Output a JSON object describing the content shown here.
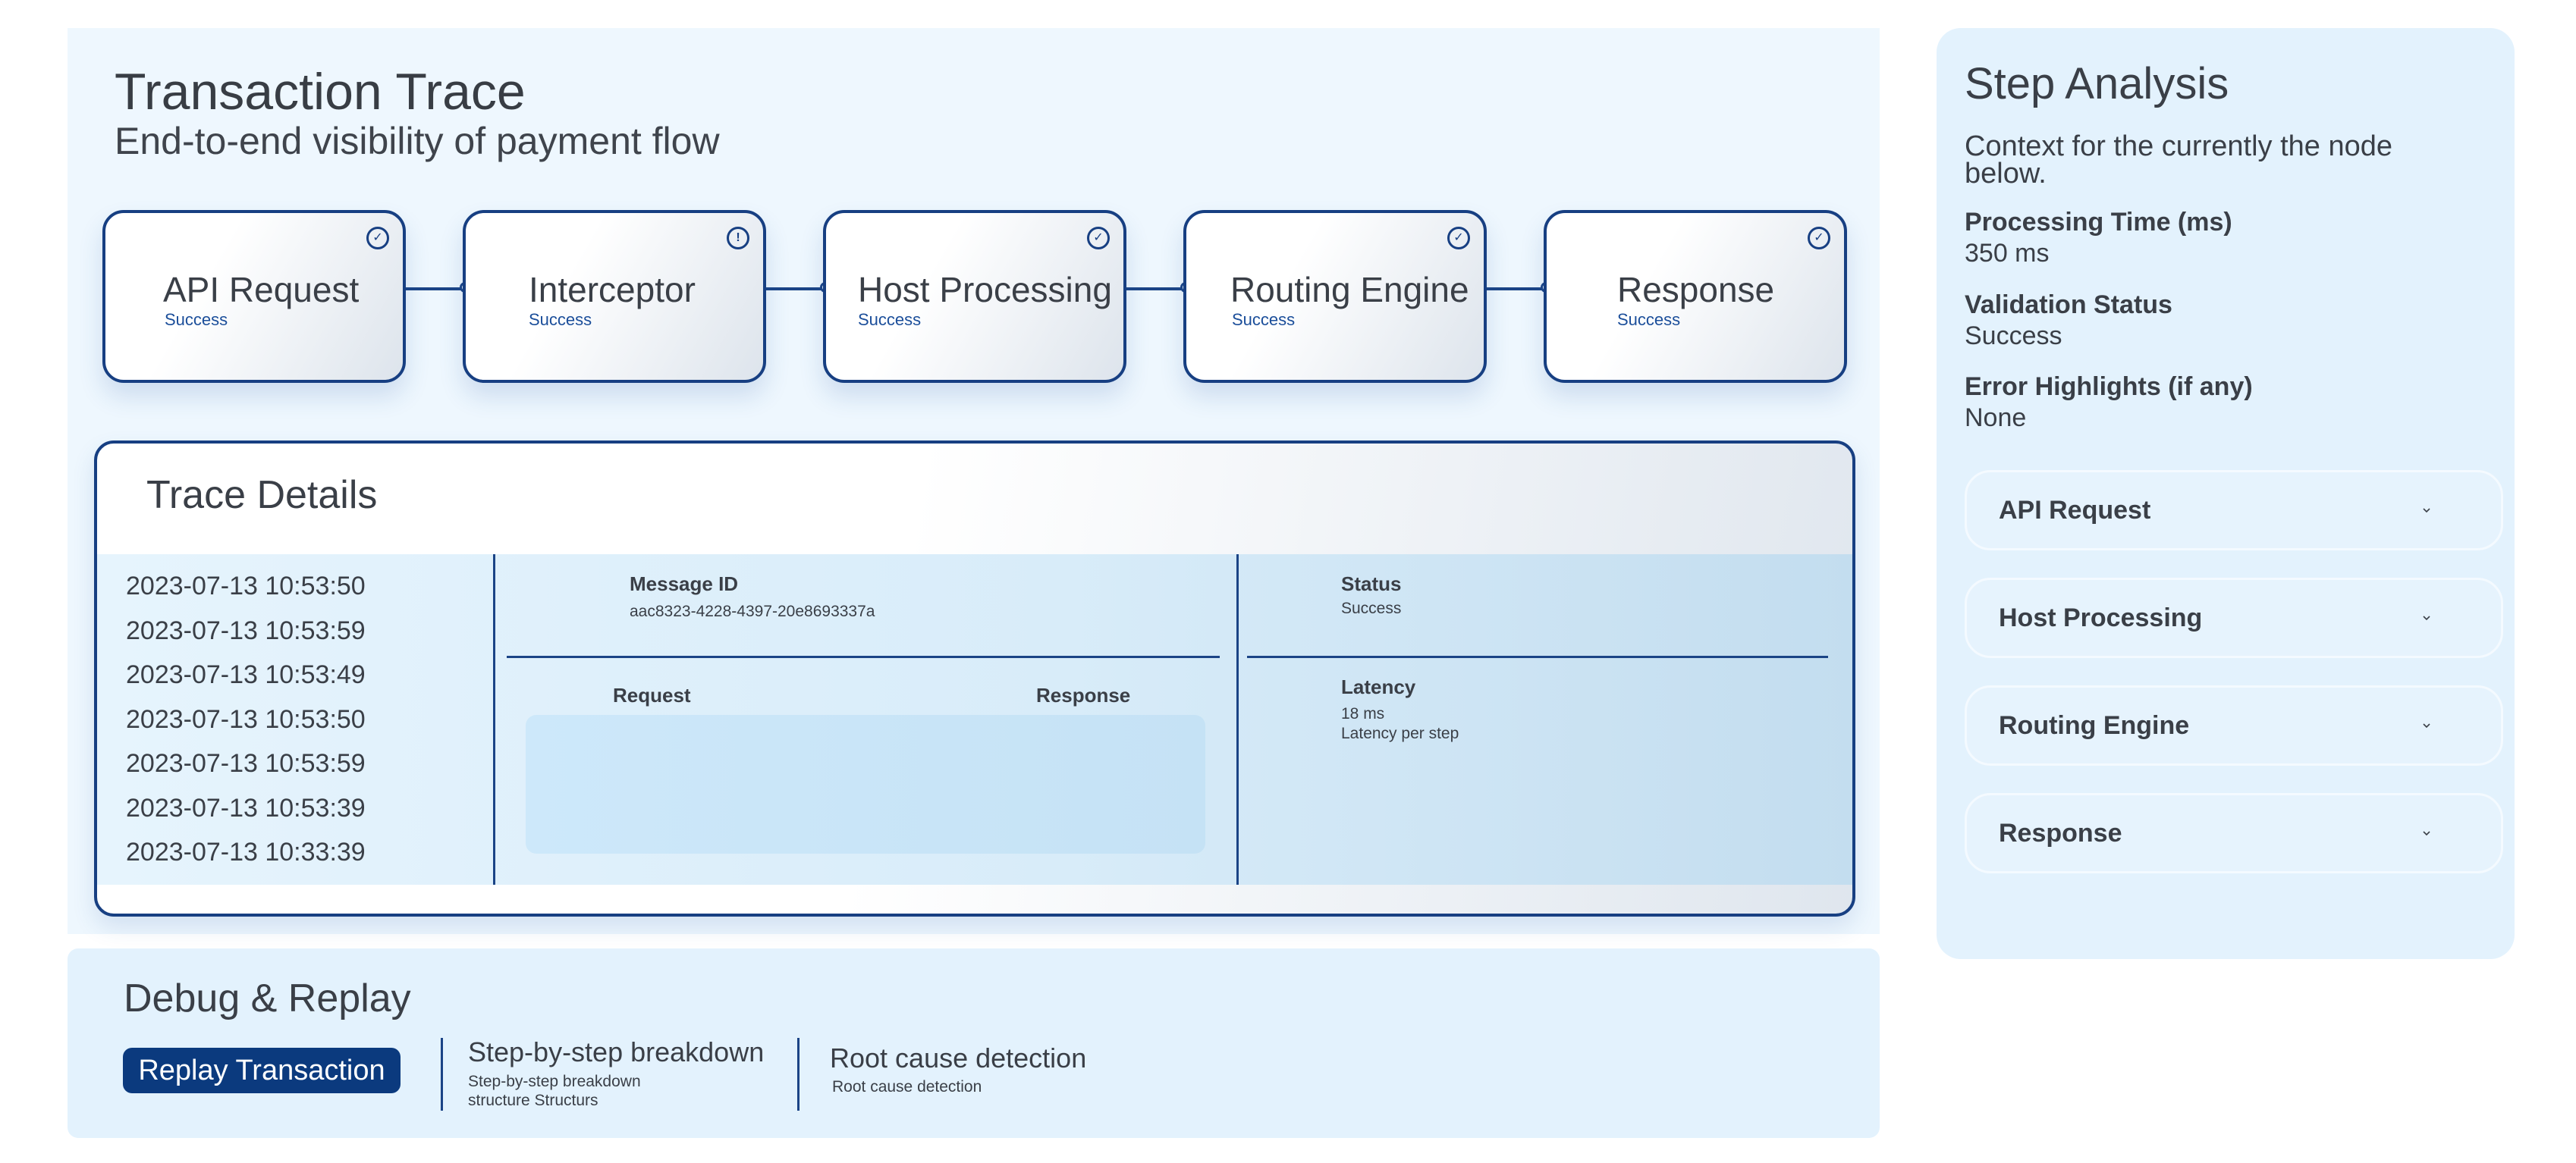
{
  "header": {
    "title": "Transaction Trace",
    "subtitle": "End-to-end visibility of payment flow"
  },
  "flow": {
    "nodes": [
      {
        "label": "API Request",
        "status": "Success",
        "badge": "check-icon"
      },
      {
        "label": "Interceptor",
        "status": "Success",
        "badge": "alert-icon"
      },
      {
        "label": "Host Processing",
        "status": "Success",
        "badge": "check-icon"
      },
      {
        "label": "Routing Engine",
        "status": "Success",
        "badge": "check-icon"
      },
      {
        "label": "Response",
        "status": "Success",
        "badge": "check-icon"
      }
    ]
  },
  "trace": {
    "title": "Trace Details",
    "timestamps": [
      "2023-07-13 10:53:50",
      "2023-07-13 10:53:59",
      "2023-07-13 10:53:49",
      "2023-07-13 10:53:50",
      "2023-07-13 10:53:59",
      "2023-07-13 10:53:39",
      "2023-07-13 10:33:39"
    ],
    "message_id_label": "Message ID",
    "message_id_value": "aac8323-4228-4397-20e8693337a",
    "request_label": "Request",
    "response_label": "Response",
    "status_label": "Status",
    "status_value": "Success",
    "latency_label": "Latency",
    "latency_value": "18 ms",
    "latency_note": "Latency per step"
  },
  "debug": {
    "title": "Debug & Replay",
    "replay_label": "Replay Transaction",
    "breakdown_title": "Step-by-step breakdown",
    "breakdown_sub1": "Step-by-step breakdown",
    "breakdown_sub2": "structure Structurs",
    "root_title": "Root cause detection",
    "root_sub": "Root cause detection"
  },
  "side": {
    "title": "Step Analysis",
    "description": "Context for the currently the node below.",
    "metrics": [
      {
        "label": "Processing Time (ms)",
        "value": "350 ms"
      },
      {
        "label": "Validation Status",
        "value": "Success"
      },
      {
        "label": "Error Highlights (if any)",
        "value": "None"
      }
    ],
    "accordion": [
      {
        "label": "API Request"
      },
      {
        "label": "Host Processing"
      },
      {
        "label": "Routing Engine"
      },
      {
        "label": "Response"
      }
    ]
  },
  "colors": {
    "accent": "#173f82",
    "button": "#0b3a7e",
    "status_text": "#1b4e9a",
    "panel_bg": "#eef7fe"
  }
}
